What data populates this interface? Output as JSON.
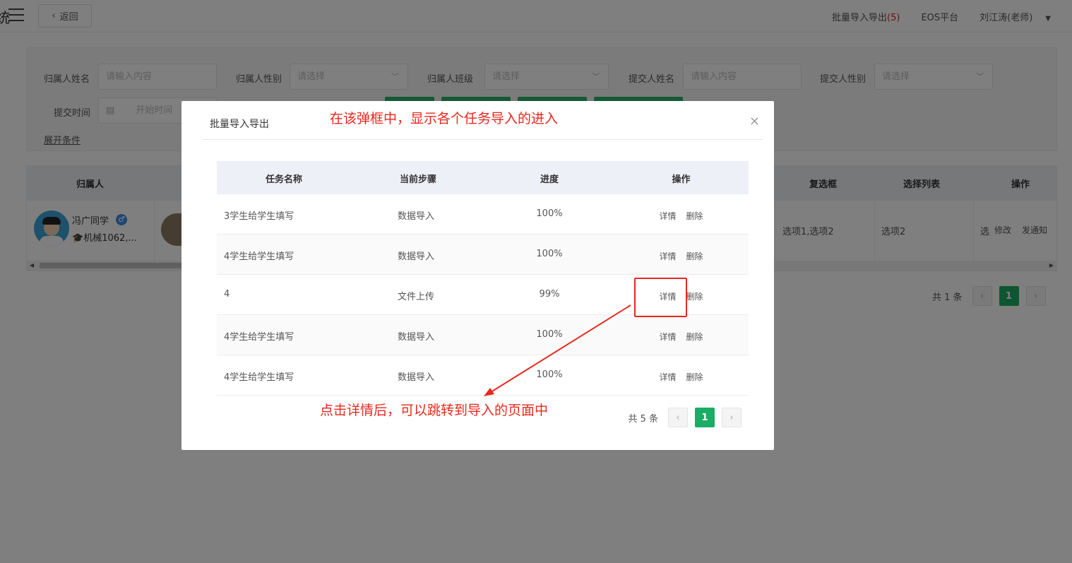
{
  "topbar": {
    "logo_fragment": "统",
    "back_label": "返回",
    "batch_label": "批量导入导出",
    "batch_count": "(5)",
    "platform_label": "EOS平台",
    "user_label": "刘江涛(老师)"
  },
  "filters": {
    "owner_name_label": "归属人姓名",
    "owner_name_placeholder": "请输入内容",
    "owner_gender_label": "归属人性别",
    "owner_gender_placeholder": "请选择",
    "owner_class_label": "归属人班级",
    "owner_class_placeholder": "请选择",
    "submitter_name_label": "提交人姓名",
    "submitter_name_placeholder": "请输入内容",
    "submitter_gender_label": "提交人性别",
    "submitter_gender_placeholder": "请选择",
    "submit_time_label": "提交时间",
    "start_time_placeholder": "开始时间",
    "expand_label": "展开条件"
  },
  "list": {
    "headers": {
      "owner": "归属人",
      "checkbox": "复选框",
      "select_list": "选择列表",
      "ops": "操作"
    },
    "row": {
      "name": "冯广同学",
      "gender_symbol": "♂",
      "class": "机械1062,...",
      "checkbox_value": "选项1,选项2",
      "select_value": "选项2",
      "truncated": "选",
      "edit": "修改",
      "notify": "发通知"
    }
  },
  "bg_pagination": {
    "total": "共 1 条",
    "current": "1"
  },
  "modal": {
    "title": "批量导入导出",
    "close_symbol": "×",
    "annotation_top": "在该弹框中，显示各个任务导入的进入",
    "annotation_bottom": "点击详情后，可以跳转到导入的页面中",
    "columns": [
      "任务名称",
      "当前步骤",
      "进度",
      "操作"
    ],
    "rows": [
      {
        "name": "3学生给学生填写",
        "step": "数据导入",
        "progress": "100%",
        "detail": "详情",
        "delete": "删除"
      },
      {
        "name": "4学生给学生填写",
        "step": "数据导入",
        "progress": "100%",
        "detail": "详情",
        "delete": "删除"
      },
      {
        "name": "4",
        "step": "文件上传",
        "progress": "99%",
        "detail": "详情",
        "delete": "删除"
      },
      {
        "name": "4学生给学生填写",
        "step": "数据导入",
        "progress": "100%",
        "detail": "详情",
        "delete": "删除"
      },
      {
        "name": "4学生给学生填写",
        "step": "数据导入",
        "progress": "100%",
        "detail": "详情",
        "delete": "删除"
      }
    ],
    "pagination": {
      "total": "共 5 条",
      "current": "1"
    }
  },
  "colors": {
    "accent_green": "#1aad65",
    "annotation_red": "#e8281e"
  }
}
